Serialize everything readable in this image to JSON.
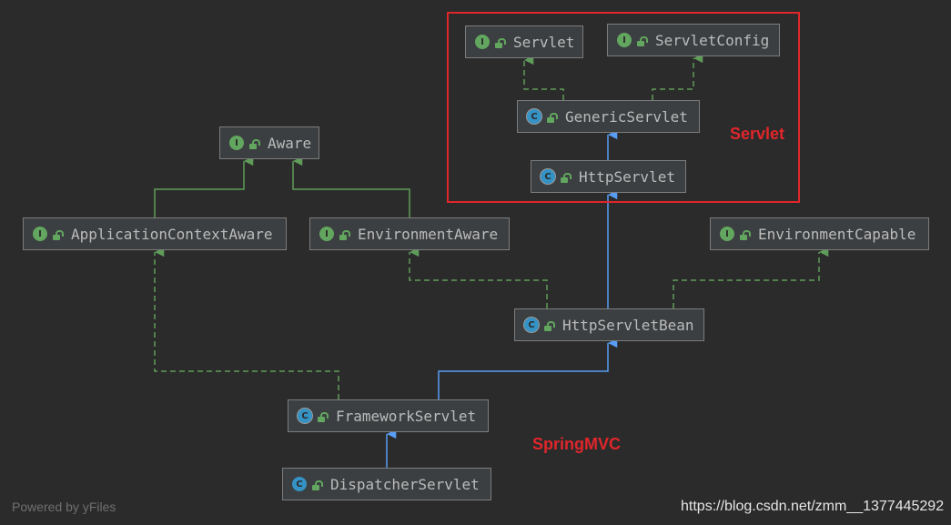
{
  "colors": {
    "background": "#2b2b2b",
    "node_fill": "#3c3f41",
    "node_border": "#7c7c7c",
    "text": "#bbbbbb",
    "interface_icon": "#62a65f",
    "class_icon": "#3592c4",
    "extends_edge": "#589df6",
    "implements_edge": "#5f9c59",
    "highlight": "#e0262b"
  },
  "nodes": {
    "servlet": {
      "label": "Servlet",
      "badge": "I",
      "kind": "interface"
    },
    "servlet_config": {
      "label": "ServletConfig",
      "badge": "I",
      "kind": "interface"
    },
    "generic_servlet": {
      "label": "GenericServlet",
      "badge": "C",
      "kind": "abstract-class"
    },
    "http_servlet": {
      "label": "HttpServlet",
      "badge": "C",
      "kind": "abstract-class"
    },
    "aware": {
      "label": "Aware",
      "badge": "I",
      "kind": "interface"
    },
    "application_context_aware": {
      "label": "ApplicationContextAware",
      "badge": "I",
      "kind": "interface"
    },
    "environment_aware": {
      "label": "EnvironmentAware",
      "badge": "I",
      "kind": "interface"
    },
    "environment_capable": {
      "label": "EnvironmentCapable",
      "badge": "I",
      "kind": "interface"
    },
    "http_servlet_bean": {
      "label": "HttpServletBean",
      "badge": "C",
      "kind": "abstract-class"
    },
    "framework_servlet": {
      "label": "FrameworkServlet",
      "badge": "C",
      "kind": "abstract-class"
    },
    "dispatcher_servlet": {
      "label": "DispatcherServlet",
      "badge": "C",
      "kind": "class"
    }
  },
  "edges": [
    {
      "from": "generic_servlet",
      "to": "servlet",
      "type": "implements"
    },
    {
      "from": "generic_servlet",
      "to": "servlet_config",
      "type": "implements"
    },
    {
      "from": "http_servlet",
      "to": "generic_servlet",
      "type": "extends"
    },
    {
      "from": "http_servlet_bean",
      "to": "http_servlet",
      "type": "extends"
    },
    {
      "from": "application_context_aware",
      "to": "aware",
      "type": "interface-extends"
    },
    {
      "from": "environment_aware",
      "to": "aware",
      "type": "interface-extends"
    },
    {
      "from": "http_servlet_bean",
      "to": "environment_aware",
      "type": "implements"
    },
    {
      "from": "http_servlet_bean",
      "to": "environment_capable",
      "type": "implements"
    },
    {
      "from": "framework_servlet",
      "to": "http_servlet_bean",
      "type": "extends"
    },
    {
      "from": "framework_servlet",
      "to": "application_context_aware",
      "type": "implements"
    },
    {
      "from": "dispatcher_servlet",
      "to": "framework_servlet",
      "type": "extends"
    }
  ],
  "annotations": {
    "servlet_group": "Servlet",
    "springmvc_group": "SpringMVC"
  },
  "footer": {
    "powered_by": "Powered by yFiles",
    "source_url": "https://blog.csdn.net/zmm__1377445292"
  }
}
